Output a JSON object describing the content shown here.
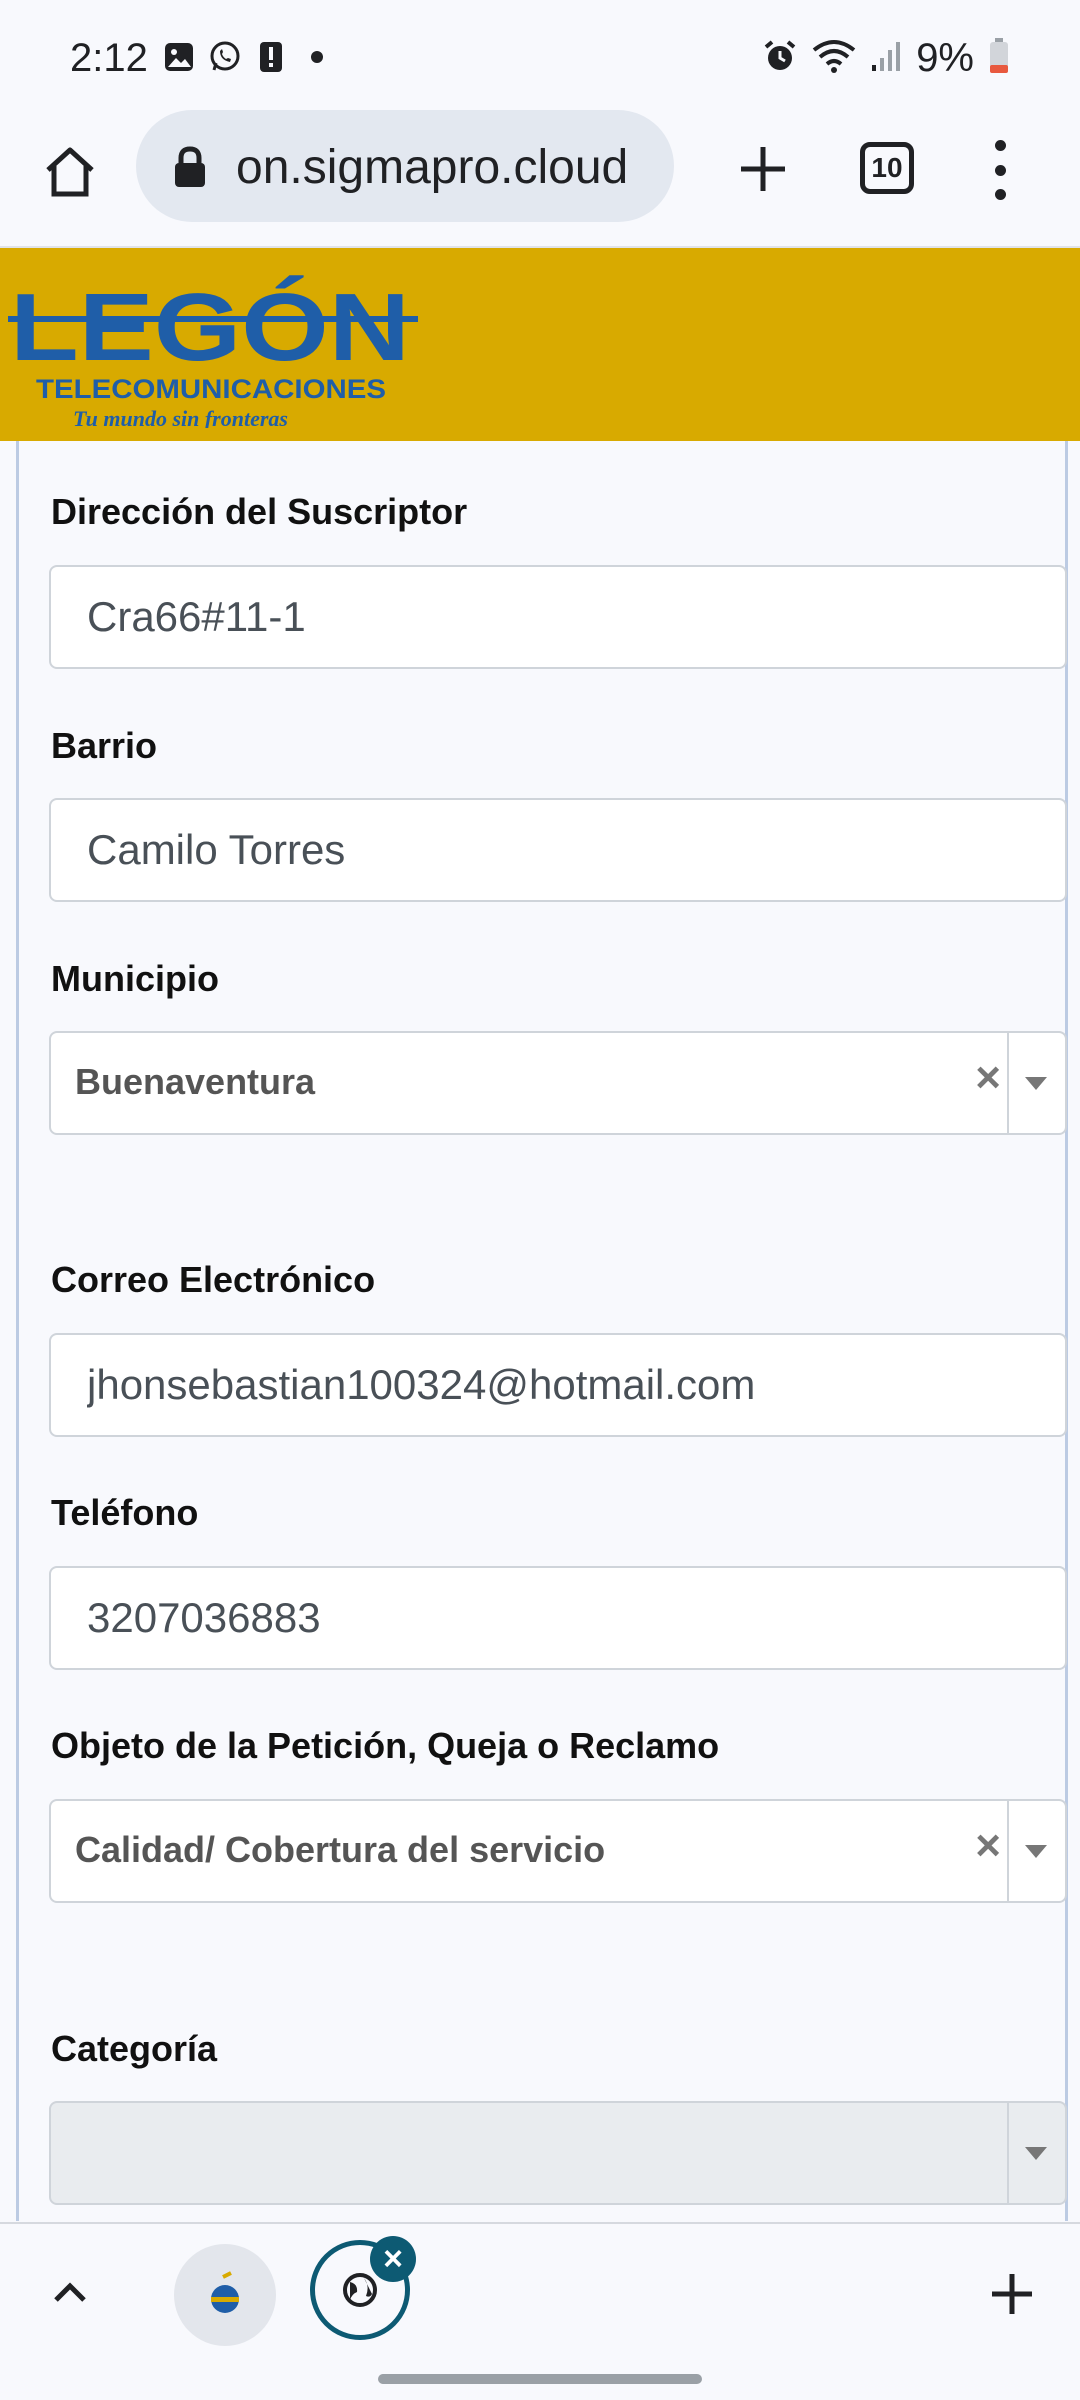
{
  "status_bar": {
    "time": "2:12",
    "battery": "9%",
    "left_icons": [
      "image-icon",
      "whatsapp-icon",
      "alert-icon",
      "dot-icon"
    ],
    "right_icons": [
      "alarm-icon",
      "wifi-icon",
      "signal-icon",
      "battery-icon"
    ]
  },
  "browser": {
    "url": "on.sigmapro.cloud",
    "tab_count": "10"
  },
  "brand": {
    "name": "LEGÓN",
    "subtitle": "TELECOMUNICACIONES",
    "tagline": "Tu mundo sin fronteras",
    "color": "#d8aa00",
    "logo_color": "#1f5ea8"
  },
  "form": {
    "direccion": {
      "label": "Dirección del Suscriptor",
      "value": "Cra66#11-1"
    },
    "barrio": {
      "label": "Barrio",
      "value": "Camilo Torres"
    },
    "municipio": {
      "label": "Municipio",
      "value": "Buenaventura"
    },
    "correo": {
      "label": "Correo Electrónico",
      "value": "jhonsebastian100324@hotmail.com"
    },
    "telefono": {
      "label": "Teléfono",
      "value": "3207036883"
    },
    "objeto": {
      "label": "Objeto de la Petición, Queja o Reclamo",
      "value": "Calidad/ Cobertura del servicio"
    },
    "categoria": {
      "label": "Categoría",
      "value": ""
    },
    "clear_glyph": "×"
  },
  "bottom_bar": {
    "close_glyph": "×"
  }
}
